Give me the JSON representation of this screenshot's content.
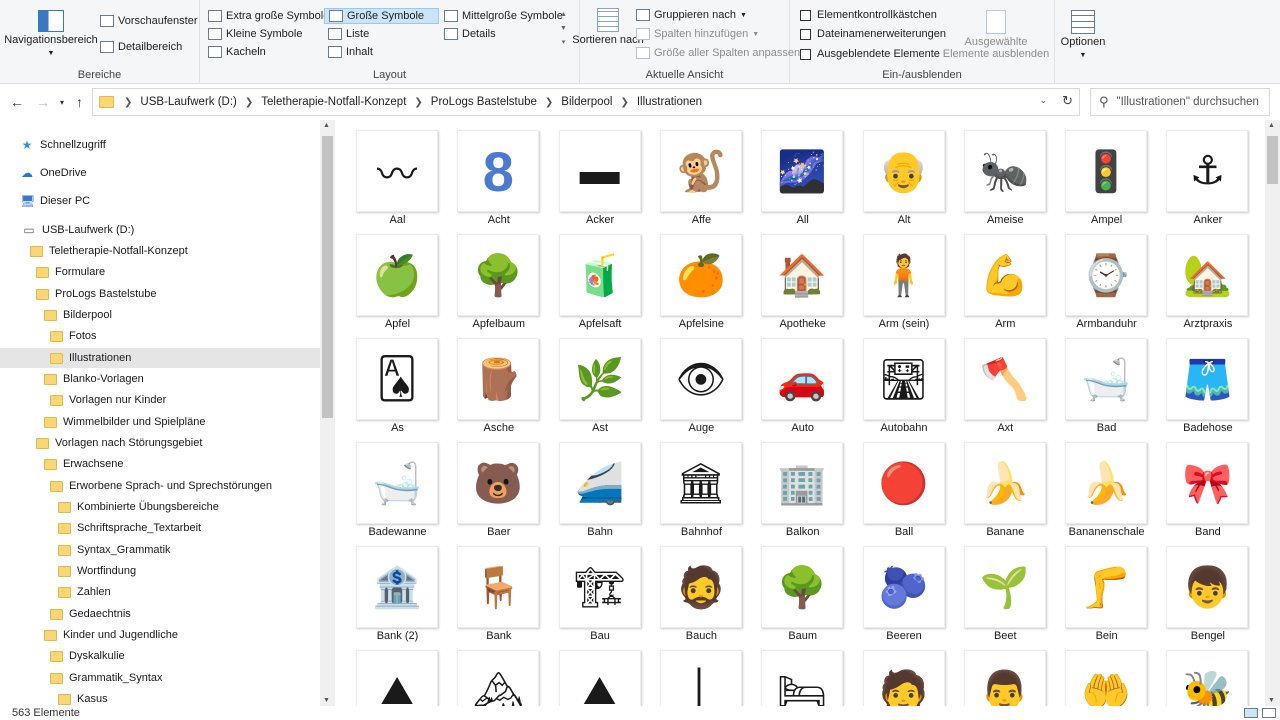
{
  "ribbon": {
    "bereiche": {
      "label": "Bereiche",
      "nav_pane": "Navigationsbereich",
      "preview": "Vorschaufenster",
      "details": "Detailbereich"
    },
    "layout": {
      "label": "Layout",
      "items": [
        "Extra große Symbole",
        "Große Symbole",
        "Mittelgroße Symbole",
        "Kleine Symbole",
        "Liste",
        "Details",
        "Kacheln",
        "Inhalt"
      ],
      "selected": "Große Symbole"
    },
    "ansicht": {
      "label": "Aktuelle Ansicht",
      "sort": "Sortieren nach",
      "group": "Gruppieren nach",
      "add_cols": "Spalten hinzufügen",
      "fit_cols": "Größe aller Spalten anpassen"
    },
    "einaus": {
      "label": "Ein-/ausblenden",
      "checkboxes": "Elementkontrollkästchen",
      "extensions": "Dateinamenerweiterungen",
      "hidden": "Ausgeblendete Elemente",
      "hide_selected": "Ausgewählte Elemente ausblenden"
    },
    "options": "Optionen"
  },
  "address": {
    "crumbs": [
      "USB-Laufwerk (D:)",
      "Teletherapie-Notfall-Konzept",
      "ProLogs Bastelstube",
      "Bilderpool",
      "Illustrationen"
    ],
    "search_placeholder": "\"Illustrationen\" durchsuchen"
  },
  "tree": [
    {
      "label": "Schnellzugriff",
      "icon": "star-icon"
    },
    {
      "label": "OneDrive",
      "icon": "cloud-icon"
    },
    {
      "label": "Dieser PC",
      "icon": "pc-icon"
    },
    {
      "label": "USB-Laufwerk (D:)",
      "icon": "drive-icon"
    },
    {
      "label": "Teletherapie-Notfall-Konzept",
      "icon": "folder-icon"
    },
    {
      "label": "Formulare",
      "icon": "folder-icon"
    },
    {
      "label": "ProLogs Bastelstube",
      "icon": "folder-icon"
    },
    {
      "label": "Bilderpool",
      "icon": "folder-icon"
    },
    {
      "label": "Fotos",
      "icon": "folder-icon"
    },
    {
      "label": "Illustrationen",
      "icon": "folder-icon"
    },
    {
      "label": "Blanko-Vorlagen",
      "icon": "folder-icon"
    },
    {
      "label": "Vorlagen nur Kinder",
      "icon": "folder-icon"
    },
    {
      "label": "Wimmelbilder und Spielpläne",
      "icon": "folder-icon"
    },
    {
      "label": "Vorlagen nach Störungsgebiet",
      "icon": "folder-icon"
    },
    {
      "label": "Erwachsene",
      "icon": "folder-icon"
    },
    {
      "label": "Erworbene Sprach- und Sprechstörungen",
      "icon": "folder-icon"
    },
    {
      "label": "Kombinierte Übungsbereiche",
      "icon": "folder-icon"
    },
    {
      "label": "Schriftsprache_Textarbeit",
      "icon": "folder-icon"
    },
    {
      "label": "Syntax_Grammatik",
      "icon": "folder-icon"
    },
    {
      "label": "Wortfindung",
      "icon": "folder-icon"
    },
    {
      "label": "Zahlen",
      "icon": "folder-icon"
    },
    {
      "label": "Gedaechtnis",
      "icon": "folder-icon"
    },
    {
      "label": "Kinder und Jugendliche",
      "icon": "folder-icon"
    },
    {
      "label": "Dyskalkulie",
      "icon": "folder-icon"
    },
    {
      "label": "Grammatik_Syntax",
      "icon": "folder-icon"
    },
    {
      "label": "Kasus",
      "icon": "folder-icon"
    }
  ],
  "files": [
    {
      "name": "Aal",
      "glyph": "〰"
    },
    {
      "name": "Acht",
      "glyph": "8"
    },
    {
      "name": "Acker",
      "glyph": "▬"
    },
    {
      "name": "Affe",
      "glyph": "🐒"
    },
    {
      "name": "All",
      "glyph": "🌌"
    },
    {
      "name": "Alt",
      "glyph": "👴"
    },
    {
      "name": "Ameise",
      "glyph": "🐜"
    },
    {
      "name": "Ampel",
      "glyph": "🚦"
    },
    {
      "name": "Anker",
      "glyph": "⚓"
    },
    {
      "name": "Apfel",
      "glyph": "🍏"
    },
    {
      "name": "Apfelbaum",
      "glyph": "🌳"
    },
    {
      "name": "Apfelsaft",
      "glyph": "🧃"
    },
    {
      "name": "Apfelsine",
      "glyph": "🍊"
    },
    {
      "name": "Apotheke",
      "glyph": "🏠"
    },
    {
      "name": "Arm (sein)",
      "glyph": "🧍"
    },
    {
      "name": "Arm",
      "glyph": "💪"
    },
    {
      "name": "Armbanduhr",
      "glyph": "⌚"
    },
    {
      "name": "Arztpraxis",
      "glyph": "🏡"
    },
    {
      "name": "As",
      "glyph": "🂡"
    },
    {
      "name": "Asche",
      "glyph": "🪵"
    },
    {
      "name": "Ast",
      "glyph": "🌿"
    },
    {
      "name": "Auge",
      "glyph": "👁"
    },
    {
      "name": "Auto",
      "glyph": "🚗"
    },
    {
      "name": "Autobahn",
      "glyph": "🛣"
    },
    {
      "name": "Axt",
      "glyph": "🪓"
    },
    {
      "name": "Bad",
      "glyph": "🛁"
    },
    {
      "name": "Badehose",
      "glyph": "🩳"
    },
    {
      "name": "Badewanne",
      "glyph": "🛁"
    },
    {
      "name": "Baer",
      "glyph": "🐻"
    },
    {
      "name": "Bahn",
      "glyph": "🚄"
    },
    {
      "name": "Bahnhof",
      "glyph": "🏛"
    },
    {
      "name": "Balkon",
      "glyph": "🏢"
    },
    {
      "name": "Ball",
      "glyph": "🔴"
    },
    {
      "name": "Banane",
      "glyph": "🍌"
    },
    {
      "name": "Bananenschale",
      "glyph": "🍌"
    },
    {
      "name": "Band",
      "glyph": "🎀"
    },
    {
      "name": "Bank (2)",
      "glyph": "🏦"
    },
    {
      "name": "Bank",
      "glyph": "🪑"
    },
    {
      "name": "Bau",
      "glyph": "🏗"
    },
    {
      "name": "Bauch",
      "glyph": "🧔"
    },
    {
      "name": "Baum",
      "glyph": "🌳"
    },
    {
      "name": "Beeren",
      "glyph": "🫐"
    },
    {
      "name": "Beet",
      "glyph": "🌱"
    },
    {
      "name": "Bein",
      "glyph": "🦵"
    },
    {
      "name": "Bengel",
      "glyph": "👦"
    },
    {
      "name": "",
      "glyph": "⛰"
    },
    {
      "name": "",
      "glyph": "🏔"
    },
    {
      "name": "",
      "glyph": "⛰"
    },
    {
      "name": "",
      "glyph": "│"
    },
    {
      "name": "",
      "glyph": "🛏"
    },
    {
      "name": "",
      "glyph": "🧑"
    },
    {
      "name": "",
      "glyph": "👨"
    },
    {
      "name": "",
      "glyph": "🤲"
    },
    {
      "name": "",
      "glyph": "🐝"
    }
  ],
  "status": "563 Elemente"
}
